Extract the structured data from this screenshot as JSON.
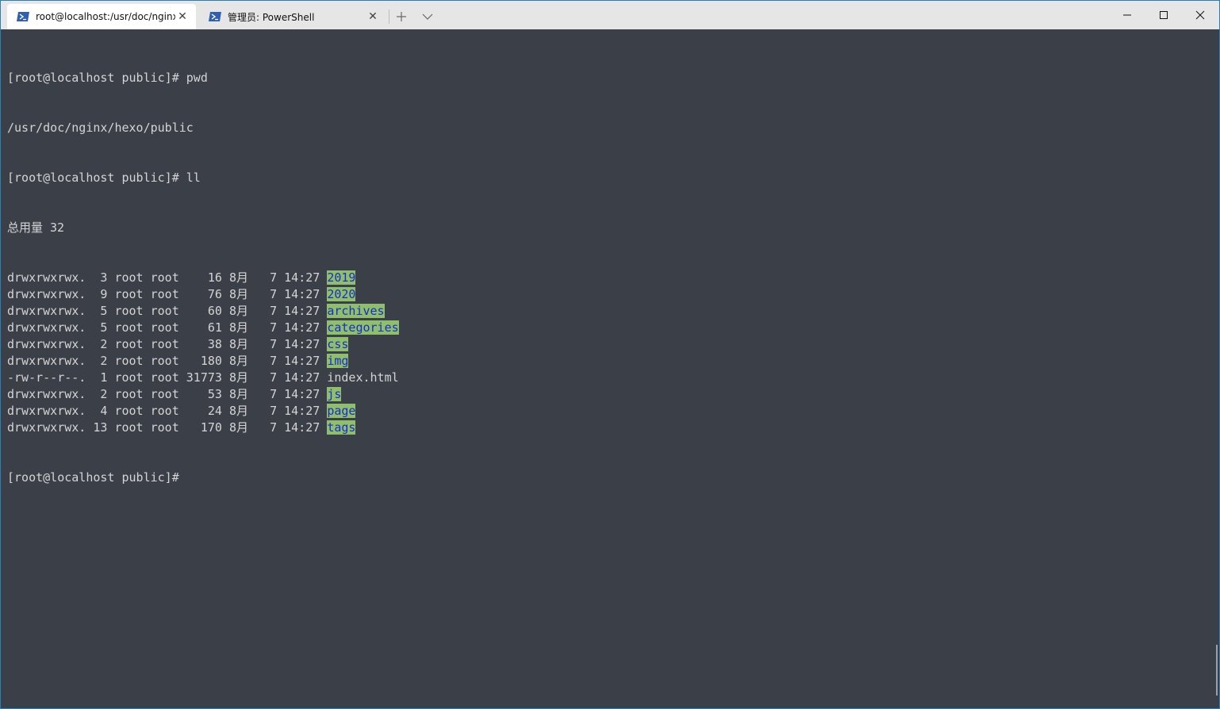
{
  "tabs": [
    {
      "label": "root@localhost:/usr/doc/nginx/",
      "icon": "powershell-icon",
      "active": true
    },
    {
      "label": "管理员: PowerShell",
      "icon": "powershell-icon",
      "active": false
    }
  ],
  "tab_controls": {
    "new_tab": "+",
    "dropdown": "⌄"
  },
  "window_controls": {
    "minimize": "—",
    "maximize": "☐",
    "close": "✕"
  },
  "terminal": {
    "lines": [
      "[root@localhost public]# pwd",
      "/usr/doc/nginx/hexo/public",
      "[root@localhost public]# ll",
      "总用量 32"
    ],
    "listing": [
      {
        "prefix": "drwxrwxrwx.  3 root root    16 8月   7 14:27 ",
        "name": "2019",
        "is_dir": true
      },
      {
        "prefix": "drwxrwxrwx.  9 root root    76 8月   7 14:27 ",
        "name": "2020",
        "is_dir": true
      },
      {
        "prefix": "drwxrwxrwx.  5 root root    60 8月   7 14:27 ",
        "name": "archives",
        "is_dir": true
      },
      {
        "prefix": "drwxrwxrwx.  5 root root    61 8月   7 14:27 ",
        "name": "categories",
        "is_dir": true
      },
      {
        "prefix": "drwxrwxrwx.  2 root root    38 8月   7 14:27 ",
        "name": "css",
        "is_dir": true
      },
      {
        "prefix": "drwxrwxrwx.  2 root root   180 8月   7 14:27 ",
        "name": "img",
        "is_dir": true
      },
      {
        "prefix": "-rw-r--r--.  1 root root 31773 8月   7 14:27 ",
        "name": "index.html",
        "is_dir": false
      },
      {
        "prefix": "drwxrwxrwx.  2 root root    53 8月   7 14:27 ",
        "name": "js",
        "is_dir": true
      },
      {
        "prefix": "drwxrwxrwx.  4 root root    24 8月   7 14:27 ",
        "name": "page",
        "is_dir": true
      },
      {
        "prefix": "drwxrwxrwx. 13 root root   170 8月   7 14:27 ",
        "name": "tags",
        "is_dir": true
      }
    ],
    "prompt": "[root@localhost public]#"
  },
  "colors": {
    "terminal_bg": "#3b3f48",
    "terminal_fg": "#d4d4d4",
    "dir_bg": "#8fbf6a",
    "dir_fg": "#1a2ccf",
    "titlebar_bg": "#e6e6e6"
  }
}
